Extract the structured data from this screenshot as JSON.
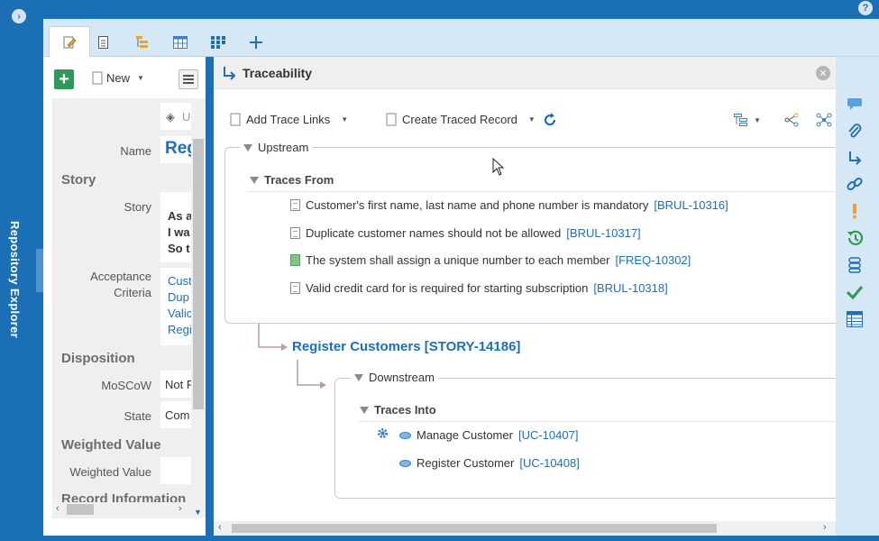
{
  "rail": {
    "label": "Repository Explorer",
    "toggle_icon": "chevron-right-icon"
  },
  "help_label": "?",
  "tabs": [
    {
      "icon": "edit-document-icon",
      "active": true
    },
    {
      "icon": "document-icon",
      "active": false
    },
    {
      "icon": "hierarchy-list-icon",
      "active": false
    },
    {
      "icon": "table-icon",
      "active": false
    },
    {
      "icon": "grid-icon",
      "active": false
    },
    {
      "icon": "plus-icon",
      "active": false
    }
  ],
  "left_panel": {
    "add_label": "+",
    "new_label": "New",
    "top_field_value": "U",
    "fields": {
      "name_label": "Name",
      "name_value": "Reg",
      "story_section": "Story",
      "story_label": "Story",
      "story_lines": [
        "As a",
        "I wa",
        "So t"
      ],
      "acceptance_label_1": "Acceptance",
      "acceptance_label_2": "Criteria",
      "acceptance_lines": [
        "Cust",
        "Dup",
        "Valic",
        "Regi"
      ],
      "disposition_section": "Disposition",
      "moscow_label": "MoSCoW",
      "moscow_value": "Not F",
      "state_label": "State",
      "state_value": "Com",
      "weighted_section": "Weighted Value",
      "weighted_label": "Weighted Value",
      "record_section": "Record Information"
    }
  },
  "main": {
    "title": "Traceability",
    "toolbar": {
      "add_trace_links": "Add Trace Links",
      "create_traced_record": "Create Traced Record"
    },
    "upstream": {
      "label": "Upstream",
      "traces_from_label": "Traces From",
      "items": [
        {
          "text": "Customer's first name, last name and phone number is mandatory",
          "id": "[BRUL-10316]",
          "icon": "document-icon"
        },
        {
          "text": "Duplicate customer names should not be allowed",
          "id": "[BRUL-10317]",
          "icon": "document-icon"
        },
        {
          "text": "The system shall assign a unique number to each member",
          "id": "[FREQ-10302]",
          "icon": "green-document-icon"
        },
        {
          "text": "Valid credit card for is required for starting subscription",
          "id": "[BRUL-10318]",
          "icon": "document-icon"
        }
      ]
    },
    "story": {
      "text": "Register Customers [STORY-14186]"
    },
    "downstream": {
      "label": "Downstream",
      "traces_into_label": "Traces Into",
      "items": [
        {
          "text": "Manage Customer",
          "id": "[UC-10407]",
          "icon": "use-case-icon"
        },
        {
          "text": "Register Customer",
          "id": "[UC-10408]",
          "icon": "use-case-icon"
        }
      ]
    }
  },
  "right_icons": [
    "comment-icon",
    "attachment-icon",
    "trace-arrow-icon",
    "link-icon",
    "alert-icon",
    "history-icon",
    "workflow-icon",
    "approve-check-icon",
    "table-view-icon"
  ],
  "colors": {
    "brand_blue": "#1b6fb5",
    "link_blue": "#1d6fb8",
    "add_green": "#2e9a58",
    "panel_bg": "#d6e7f6"
  }
}
